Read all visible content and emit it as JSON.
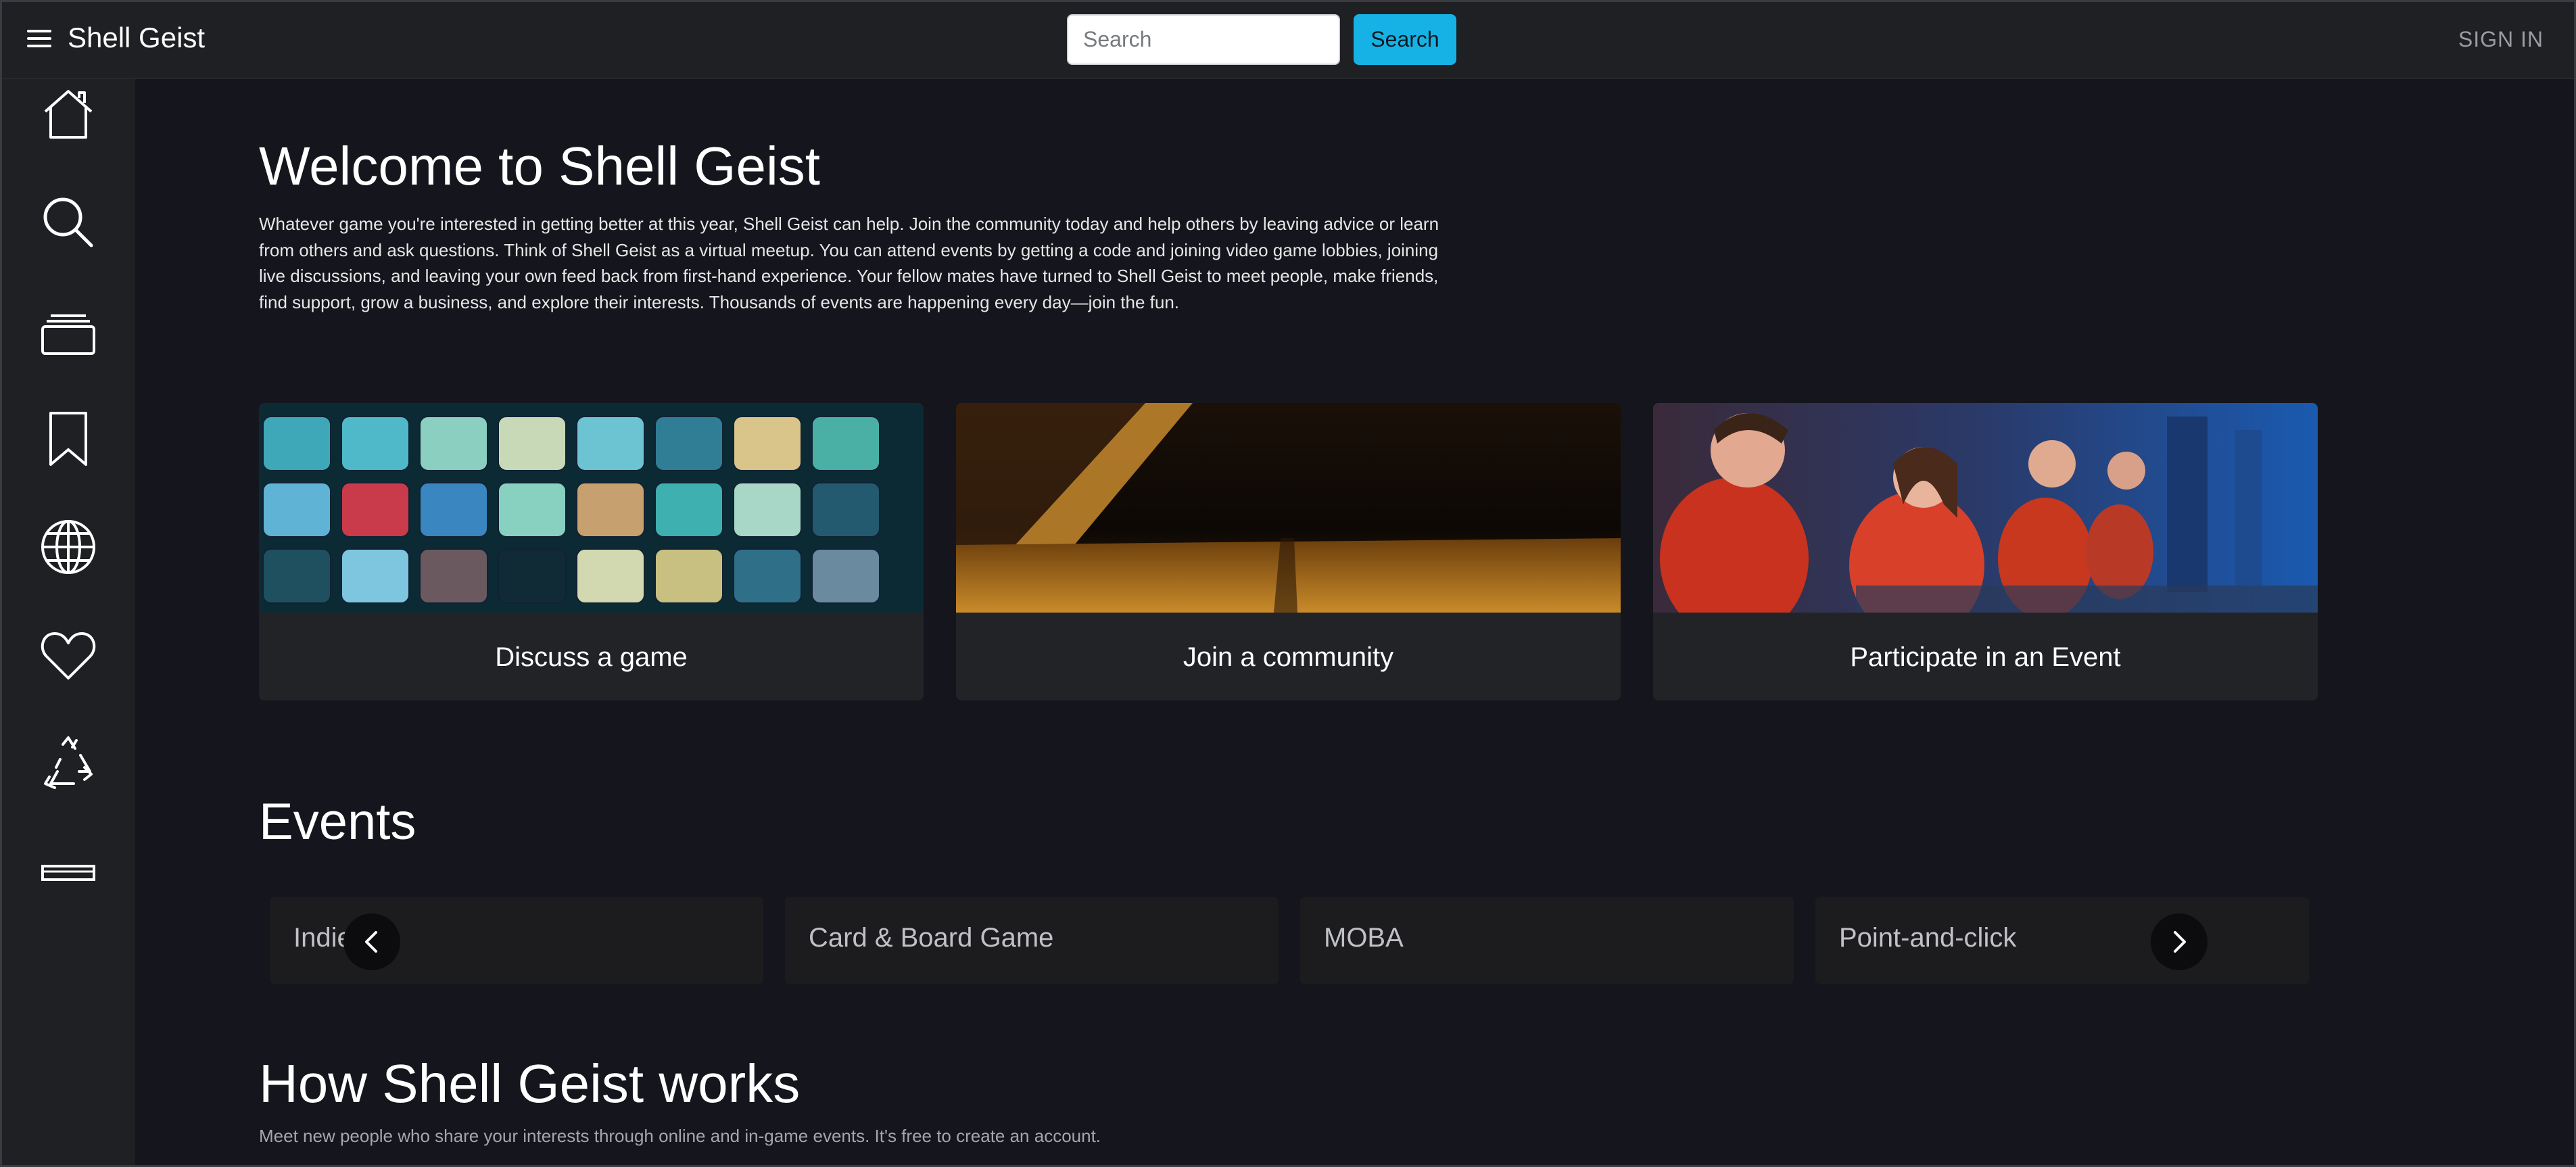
{
  "app": {
    "brand": "Shell Geist"
  },
  "header": {
    "search_placeholder": "Search",
    "search_button": "Search",
    "sign_in": "SIGN IN"
  },
  "sidebar": {
    "icons": [
      "home-icon",
      "search-icon",
      "library-icon",
      "bookmark-icon",
      "globe-icon",
      "heart-icon",
      "recycle-icon",
      "bar-icon"
    ]
  },
  "welcome": {
    "title": "Welcome to Shell Geist",
    "intro": "Whatever game you're interested in getting better at this year, Shell Geist can help. Join the community today and help others by leaving advice or learn from others and ask questions. Think of Shell Geist as a virtual meetup. You can attend events by getting a code and joining video game lobbies, joining live discussions, and leaving your own feed back from first-hand experience. Your fellow mates have turned to Shell Geist to meet people, make friends, find support, grow a business, and explore their interests. Thousands of events are happening every day—join the fun."
  },
  "cards": [
    {
      "label": "Discuss a game"
    },
    {
      "label": "Join a community"
    },
    {
      "label": "Participate in an Event"
    }
  ],
  "events": {
    "title": "Events",
    "items": [
      "Indie",
      "Card & Board Game",
      "MOBA",
      "Point-and-click"
    ]
  },
  "how": {
    "title": "How Shell Geist works",
    "text": "Meet new people who share your interests through online and in-game events. It's free to create an account."
  },
  "colors": {
    "background": "#15151d",
    "panel": "#1e2023",
    "accent": "#16b2e6",
    "card": "#212327"
  }
}
